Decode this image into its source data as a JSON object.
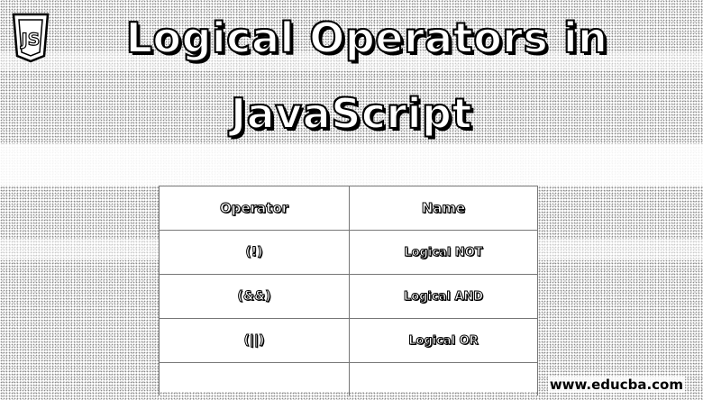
{
  "title": {
    "line1": "Logical Operators in",
    "line2": "JavaScript"
  },
  "logo": {
    "icon": "js-shield-icon",
    "text": "JS"
  },
  "table": {
    "headers": [
      "Operator",
      "Name"
    ],
    "rows": [
      {
        "operator": "(!)",
        "name": "Logical NOT"
      },
      {
        "operator": "(&&)",
        "name": "Logical AND"
      },
      {
        "operator": "(||)",
        "name": "Logical OR"
      }
    ]
  },
  "watermark": "www.educba.com"
}
